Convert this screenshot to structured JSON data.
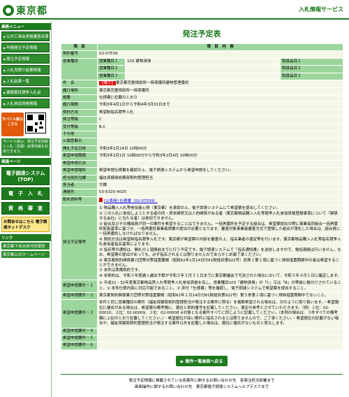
{
  "header": {
    "logo_text": "東京都",
    "system_title": "入札情報サービス"
  },
  "sidebar": {
    "section1": "業務メニュー",
    "menu": [
      "公共工事会資格審査名簿公告",
      "年間発注予定情報",
      "発注予定情報",
      "入札見積り結果情報",
      "入札結果一覧",
      "業務委託競争入札会",
      "入札参加資格情報"
    ],
    "mobile_btn": "モバイル版はこちら",
    "mobile_note": "モバイル版は、発注予定情報と入札（見積）結果情報を利用できます。",
    "section2": "関連ページ",
    "big": [
      "電子調達システム(TOP)",
      "電　子　入　札",
      "資　格　審　査"
    ],
    "tokyo_btn": "お問合せはこちら 電子調達ホットデスク",
    "section3": "リンク",
    "links": [
      "東京都下自治体共同運営",
      "東京都公式ホームページ"
    ]
  },
  "title": "発注予定表",
  "table": {
    "head_item": "項　目",
    "head_content": "項　目　内　容",
    "rows": [
      {
        "label": "契約番号",
        "value": "02-07539"
      }
    ],
    "category_label": "営業種目",
    "categories": [
      {
        "name": "営業種目１",
        "value": "103 建物清掃",
        "rank_label": "取扱品目１"
      },
      {
        "name": "営業種目２",
        "value": "",
        "rank_label": "取扱品目２"
      },
      {
        "name": "営業種目３",
        "value": "",
        "rank_label": "取扱品目３"
      }
    ],
    "subject_label": "件　名",
    "subject_badge": "【電子】",
    "subject": "東京都児童相談所一時保護所建物管理委託",
    "fields": [
      {
        "label": "履行場所",
        "value": "東京都児童相談所一時保護所"
      },
      {
        "label": "概要",
        "value": "仕様書に記載のとおり"
      },
      {
        "label": "履行期間",
        "value": "令和3年4月1日から令和4年3月31日まで"
      },
      {
        "label": "契約方法",
        "value": "希望制指名競争入札"
      },
      {
        "label": "発注等級",
        "value": "C"
      },
      {
        "label": "受付等級",
        "value": "B,C"
      },
      {
        "label": "その他",
        "value": ""
      },
      {
        "label": "公報登載日",
        "value": ""
      },
      {
        "label": "開札予定日時",
        "value": "令和3年2月24日 10時00分"
      },
      {
        "label": "希望申請期間",
        "value": "令和3年2月1日 10時00分から令和3年2月4日 10時00分"
      },
      {
        "label": "希望申請方法",
        "value": ""
      },
      {
        "label": "希望申請場所",
        "value": "希望申請仕様書を確認の上、電子調達システムから希望申請をしてください。"
      },
      {
        "label": "担当局担当課",
        "value": "福祉保健局総務部契約管理担当"
      },
      {
        "label": "担当者",
        "value": "大橋"
      },
      {
        "label": "連絡先",
        "value": "03-5320-4025"
      }
    ],
    "attachments_label": "配布資料等",
    "attachment": "[公表用] 仕様書（02-07539）",
    "notes_label": "発注予定備考",
    "notes": [
      "① 物品購入入札等参加者心得（東京都）を承認の上、電子調達システムにて希望票を提出してください。",
      "② この入札に参加しようとする者の同・資本関係又は人的関係がある者（東京都物品購入入札等競争入札参加資格登録事項について「関係する会社」に当たる者）は参加できません。",
      "③ 組合及びその構成員が同一の案件を希望することはできません。一括再委託を予定する組合は、希望票提出の際に事業協同組合一括再委託取扱基準に基づき、一括再委託事業者調書の提出が必要となります。審査対象事業者審査方式で登録した組合が落札した場合は、組合員に一括再委託しなければなりません。",
      "④ 契約方法は希望制指名競争入札です。東京都が希望票の内容を審査の上、指名業者の選定等を行います。東京都物品購入入札等指名競争入札参加者指名基準によります。",
      "⑤ 指名等の通知は、開札の１週間前までに行う予定です。電子調達システムで「指名通知書」を送信しますので、電話連絡は行いません。なお、希望票の提出があっても、必ず指名されるとは限りませんのであらかじめ御了承ください。",
      "⑥ 東京都契約関係暴力団等対策措置要綱（昭和62年1月14日付61財経庶第922号）別表１第１項に基づく排除措置期間中の者は希望することができません。",
      "⑦ 本件は準備契約です。",
      "⑧ 本契約は、令和３年度歳入歳出予算が令和３年３月３１日までに東京都議会で可決された場合において、令和３年４月１日に確定します。"
    ],
    "req_rows": [
      {
        "label": "希望申請要件－１",
        "value": "① 平成31・32年度東京都物品買入れ等競争入札参加資格を有し、営業種目103「建物清掃」の「C」又は「B」の等級に格付けされていること。② 本件仕様内容に対応可能であること。③ 添付「仕様書」等を確認し、電子調達システムで希望票を提出すること。"
      },
      {
        "label": "希望申請要件－２",
        "value": "東京都契約関係暴力団等対策措置要綱（昭和62年１月14日付61財経庶第922号）第５条第１項に基づく排除措置期間中でないこと。"
      },
      {
        "label": "希望申請要件－３",
        "value": "本件と同じ営業種目の案件（福祉保健局契約管理担当が発注する案件に限る）を複数希望される場合は、次のように取り扱います。・希望順位に優劣がある場合は、希望票の備考欄に、順位と契約番号を記載してください。選定の参考とさせていただきます。（例）１位：02-00010、２位：02-00009、３位：02-00008 ※対象となる案件すべてに同じように記載してください。（本例の場合は、３件すべての備考欄に上記のとおり記載してください。）・希望順位が高い案件に指名されるとは限りませんので、ご了承ください。・希望順位の記載がない場合や、福祉保健局契約管理担当が発注する案件以外を記載した場合は、順位に優劣がないものと見なします。"
      },
      {
        "label": "希望申請要件－４",
        "value": ""
      },
      {
        "label": "希望申請要件－５",
        "value": ""
      },
      {
        "label": "希望申請要件－６",
        "value": ""
      }
    ]
  },
  "back_button": "案件一覧画面へ戻る",
  "footer": {
    "line1": "発注予定情報に掲載されている各案件に関するお問い合わせ先　各発注担当部署まで",
    "line2": "画面操作に関するお問い合わせ先　東京都電子調達システムヘルプデスクまで"
  },
  "colors": {
    "primary": "#1d7a1d",
    "label_bg": "#9cd69c",
    "value_bg": "#f6f6e8"
  }
}
